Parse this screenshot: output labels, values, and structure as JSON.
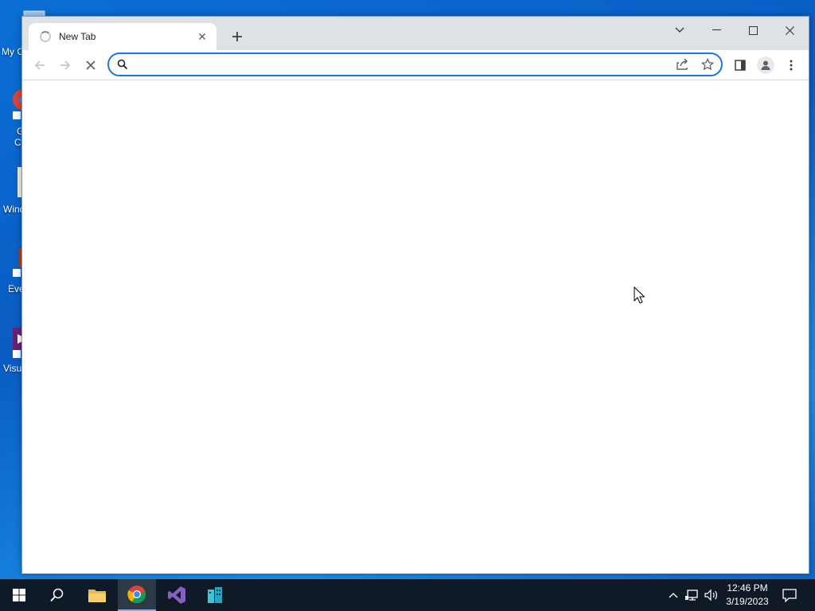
{
  "desktop": {
    "icons": [
      {
        "label": "My C"
      },
      {
        "label": "G\nCh"
      },
      {
        "label": "Wind"
      },
      {
        "label": "Eve"
      },
      {
        "label": "Visu"
      }
    ]
  },
  "browser": {
    "tab": {
      "title": "New Tab"
    },
    "omnibox": {
      "value": "",
      "placeholder": ""
    },
    "accent_color": "#1a73e8"
  },
  "taskbar": {
    "apps": [
      "start",
      "search",
      "file-explorer",
      "chrome",
      "visual-studio",
      "app-building"
    ],
    "active_app": "chrome",
    "clock": {
      "time": "12:46 PM",
      "date": "3/19/2023"
    }
  }
}
